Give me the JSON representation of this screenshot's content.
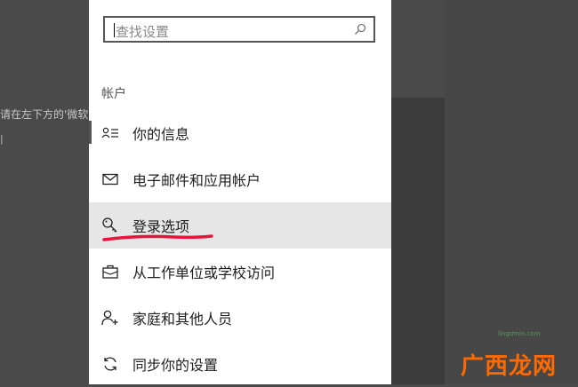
{
  "background": {
    "left_text": "请在左下方的'微软",
    "left_mark": "|"
  },
  "search": {
    "placeholder": "查找设置"
  },
  "section_title": "帐户",
  "nav_items": [
    {
      "label": "你的信息",
      "icon": "person-list-icon"
    },
    {
      "label": "电子邮件和应用帐户",
      "icon": "mail-icon"
    },
    {
      "label": "登录选项",
      "icon": "key-icon",
      "selected": true
    },
    {
      "label": "从工作单位或学校访问",
      "icon": "briefcase-icon"
    },
    {
      "label": "家庭和其他人员",
      "icon": "person-add-icon"
    },
    {
      "label": "同步你的设置",
      "icon": "sync-icon"
    }
  ],
  "watermark": {
    "text": "广西龙网",
    "url": "lingdmin.com"
  },
  "colors": {
    "selected_bg": "#e6e6e6",
    "annotation_red": "#e8143c",
    "watermark_orange": "#ff6a00"
  }
}
